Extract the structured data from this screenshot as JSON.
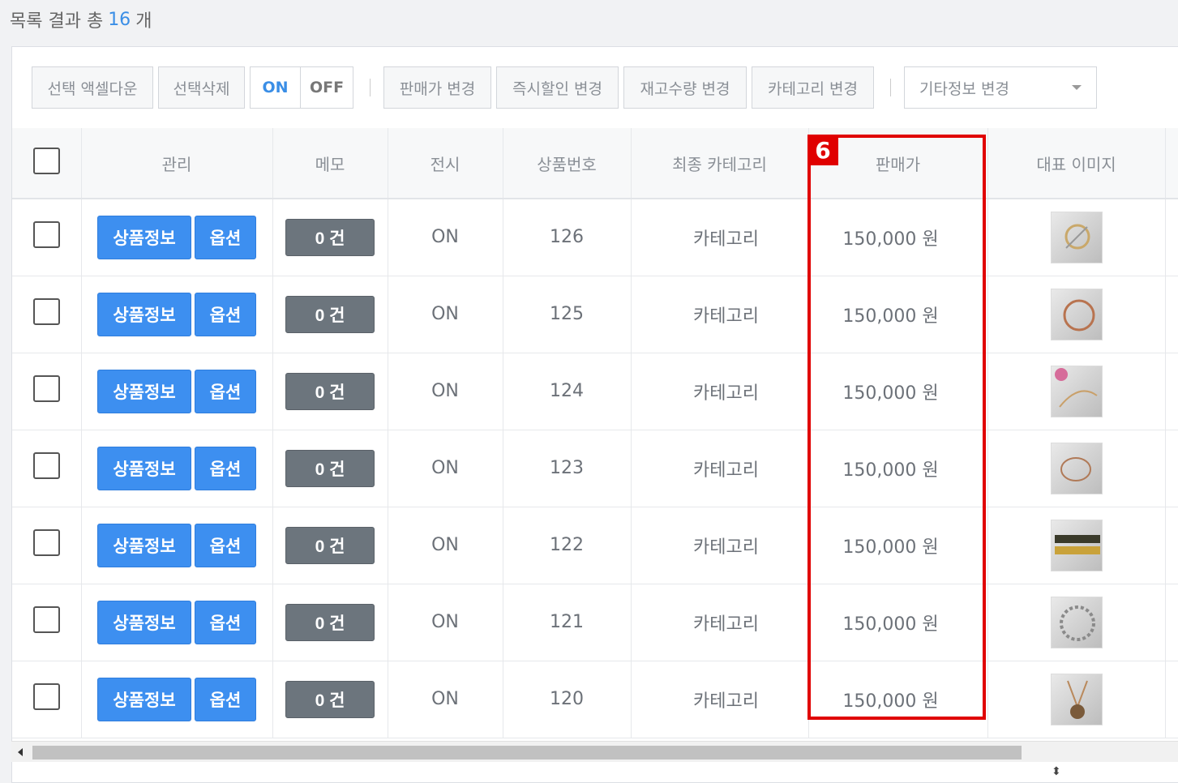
{
  "summary": {
    "prefix": "목록 결과 총",
    "count": "16",
    "suffix": "개"
  },
  "toolbar": {
    "excel_download": "선택 액셀다운",
    "delete_selected": "선택삭제",
    "on": "ON",
    "off": "OFF",
    "change_price": "판매가 변경",
    "change_discount": "즉시할인 변경",
    "change_stock": "재고수량 변경",
    "change_category": "카테고리 변경",
    "other_info_select": "기타정보 변경"
  },
  "columns": {
    "manage": "관리",
    "memo": "메모",
    "display": "전시",
    "product_no": "상품번호",
    "final_category": "최종 카테고리",
    "price": "판매가",
    "image": "대표 이미지"
  },
  "row_buttons": {
    "info": "상품정보",
    "option": "옵션"
  },
  "rows": [
    {
      "memo": "0 건",
      "display": "ON",
      "product_no": "126",
      "category": "카테고리",
      "price": "150,000 원"
    },
    {
      "memo": "0 건",
      "display": "ON",
      "product_no": "125",
      "category": "카테고리",
      "price": "150,000 원"
    },
    {
      "memo": "0 건",
      "display": "ON",
      "product_no": "124",
      "category": "카테고리",
      "price": "150,000 원"
    },
    {
      "memo": "0 건",
      "display": "ON",
      "product_no": "123",
      "category": "카테고리",
      "price": "150,000 원"
    },
    {
      "memo": "0 건",
      "display": "ON",
      "product_no": "122",
      "category": "카테고리",
      "price": "150,000 원"
    },
    {
      "memo": "0 건",
      "display": "ON",
      "product_no": "121",
      "category": "카테고리",
      "price": "150,000 원"
    },
    {
      "memo": "0 건",
      "display": "ON",
      "product_no": "120",
      "category": "카테고리",
      "price": "150,000 원"
    }
  ],
  "annotation": {
    "badge": "6"
  },
  "colors": {
    "accent": "#3d8ff0",
    "memo_button": "#6c757d",
    "highlight": "#e00000"
  }
}
